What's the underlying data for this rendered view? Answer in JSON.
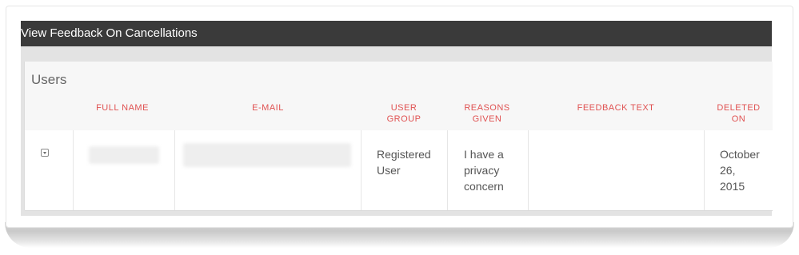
{
  "window": {
    "title": "View Feedback On Cancellations"
  },
  "panel": {
    "title": "Users"
  },
  "table": {
    "headers": {
      "full_name": "FULL NAME",
      "email": "E-MAIL",
      "user_group_1": "USER",
      "user_group_2": "GROUP",
      "reasons_1": "REASONS",
      "reasons_2": "GIVEN",
      "feedback": "FEEDBACK TEXT",
      "deleted_1": "DELETED",
      "deleted_2": "ON"
    },
    "rows": [
      {
        "full_name": "",
        "email": "",
        "user_group_1": "Registered",
        "user_group_2": "User",
        "reasons_1": "I have a",
        "reasons_2": "privacy",
        "reasons_3": "concern",
        "feedback": "",
        "deleted_1": "October",
        "deleted_2": "26,",
        "deleted_3": "2015"
      }
    ]
  },
  "icons": {
    "expand_row": "chevron-down-icon"
  },
  "colors": {
    "titlebar_bg": "#3a3a3a",
    "header_text": "#e05252",
    "panel_bg": "#f7f7f7"
  }
}
